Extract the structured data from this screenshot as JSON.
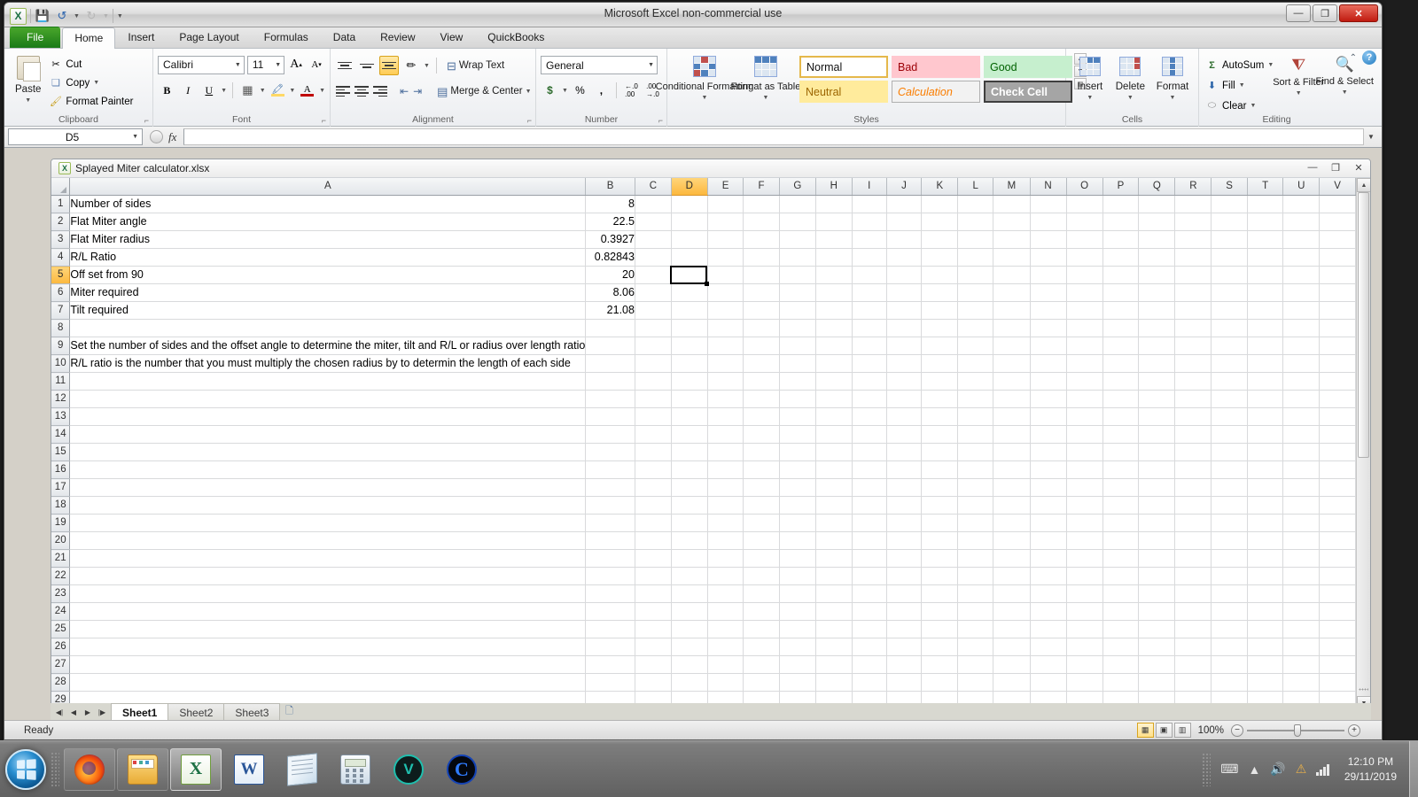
{
  "window": {
    "title": "Microsoft Excel non-commercial use",
    "minimize_label": "—",
    "maximize_label": "❐",
    "close_label": "✕"
  },
  "quick_access": {
    "excel_logo": "X",
    "save_icon": "save-icon",
    "undo_icon": "undo-icon",
    "redo_icon": "redo-icon",
    "customize_icon": "customize-qat-icon"
  },
  "ribbon": {
    "tabs": [
      {
        "label": "File",
        "active": false,
        "type": "file"
      },
      {
        "label": "Home",
        "active": true
      },
      {
        "label": "Insert",
        "active": false
      },
      {
        "label": "Page Layout",
        "active": false
      },
      {
        "label": "Formulas",
        "active": false
      },
      {
        "label": "Data",
        "active": false
      },
      {
        "label": "Review",
        "active": false
      },
      {
        "label": "View",
        "active": false
      },
      {
        "label": "QuickBooks",
        "active": false
      }
    ],
    "minimize_ribbon": "⌃",
    "help": "?",
    "groups": {
      "clipboard": {
        "name": "Clipboard",
        "paste": "Paste",
        "cut": "Cut",
        "copy": "Copy",
        "format_painter": "Format Painter",
        "launcher": "⌐"
      },
      "font": {
        "name": "Font",
        "font_name": "Calibri",
        "font_size": "11",
        "grow_font": "A",
        "shrink_font": "A",
        "bold": "B",
        "italic": "I",
        "underline": "U",
        "borders": "borders-icon",
        "fill_color": "fill-color-icon",
        "font_color": "A",
        "launcher": "⌐"
      },
      "alignment": {
        "name": "Alignment",
        "top_align": "top-align-icon",
        "middle_align": "middle-align-icon",
        "bottom_align": "bottom-align-icon",
        "orientation": "orientation-icon",
        "wrap_text": "Wrap Text",
        "align_left": "align-left-icon",
        "align_center": "align-center-icon",
        "align_right": "align-right-icon",
        "decrease_indent": "decrease-indent-icon",
        "increase_indent": "increase-indent-icon",
        "merge_center": "Merge & Center",
        "launcher": "⌐"
      },
      "number": {
        "name": "Number",
        "format": "General",
        "accounting": "$",
        "percent": "%",
        "comma": ",",
        "increase_decimal": "increase-decimal-icon",
        "decrease_decimal": "decrease-decimal-icon",
        "launcher": "⌐"
      },
      "styles": {
        "name": "Styles",
        "conditional_formatting": "Conditional Formatting",
        "format_as_table": "Format as Table",
        "cell_styles": [
          {
            "label": "Normal",
            "variant": "normal"
          },
          {
            "label": "Bad",
            "variant": "bad"
          },
          {
            "label": "Good",
            "variant": "good"
          },
          {
            "label": "Neutral",
            "variant": "neutral"
          },
          {
            "label": "Calculation",
            "variant": "calc"
          },
          {
            "label": "Check Cell",
            "variant": "check"
          }
        ]
      },
      "cells": {
        "name": "Cells",
        "insert": "Insert",
        "delete": "Delete",
        "format": "Format"
      },
      "editing": {
        "name": "Editing",
        "autosum": "AutoSum",
        "fill": "Fill",
        "clear": "Clear",
        "sort_filter": "Sort & Filter",
        "find_select": "Find & Select"
      }
    }
  },
  "formula_bar": {
    "name_box": "D5",
    "formula": "",
    "fx_label": "fx",
    "expand_icon": "expand-formula-bar-icon"
  },
  "workbook": {
    "filename": "Splayed Miter calculator.xlsx",
    "minimize": "—",
    "maximize": "❐",
    "close": "✕"
  },
  "grid": {
    "columns": [
      "A",
      "B",
      "C",
      "D",
      "E",
      "F",
      "G",
      "H",
      "I",
      "J",
      "K",
      "L",
      "M",
      "N",
      "O",
      "P",
      "Q",
      "R",
      "S",
      "T",
      "U",
      "V"
    ],
    "selected_column": "D",
    "selected_row": 5,
    "selected_cell": "D5",
    "row_count": 30,
    "cells": {
      "1": {
        "A": "Number of sides",
        "B": "8"
      },
      "2": {
        "A": "Flat Miter angle",
        "B": "22.5"
      },
      "3": {
        "A": "Flat Miter radius",
        "B": "0.3927"
      },
      "4": {
        "A": "R/L Ratio",
        "B": "0.82843"
      },
      "5": {
        "A": "Off set from 90",
        "B": "20"
      },
      "6": {
        "A": "Miter required",
        "B": "8.06"
      },
      "7": {
        "A": "Tilt required",
        "B": "21.08"
      },
      "9": {
        "A": "Set the number of sides and the offset angle to determine the miter, tilt and R/L or radius over length ratio"
      },
      "10": {
        "A": "R/L ratio is the number that you must multiply the chosen radius by to determin the length of each side"
      }
    }
  },
  "sheet_tabs": {
    "nav_first": "◀|",
    "nav_prev": "◀",
    "nav_next": "▶",
    "nav_last": "|▶",
    "tabs": [
      {
        "label": "Sheet1",
        "active": true
      },
      {
        "label": "Sheet2",
        "active": false
      },
      {
        "label": "Sheet3",
        "active": false
      }
    ],
    "insert_sheet": "insert-worksheet-icon"
  },
  "status_bar": {
    "status": "Ready",
    "view_normal": "normal-view-icon",
    "view_page_layout": "page-layout-view-icon",
    "view_page_break": "page-break-view-icon",
    "zoom": "100%",
    "zoom_out": "−",
    "zoom_in": "+"
  },
  "taskbar": {
    "start": "start-button",
    "items": [
      {
        "name": "firefox",
        "icon": "firefox-icon",
        "label": ""
      },
      {
        "name": "file-explorer",
        "icon": "file-explorer-icon",
        "label": ""
      },
      {
        "name": "excel",
        "icon": "excel-icon",
        "label": "X",
        "active": true
      },
      {
        "name": "word",
        "icon": "word-icon",
        "label": "W"
      },
      {
        "name": "notepad",
        "icon": "notepad-icon",
        "label": ""
      },
      {
        "name": "calculator",
        "icon": "calculator-icon",
        "label": ""
      },
      {
        "name": "vpn",
        "icon": "shield-icon",
        "label": "V"
      },
      {
        "name": "chrome-like",
        "icon": "circle-c-icon",
        "label": "C"
      }
    ],
    "tray": {
      "keyboard": "keyboard-icon",
      "show_hidden": "▲",
      "volume": "volume-icon",
      "network_alert": "network-warning-icon",
      "signal": "signal-icon",
      "time": "12:10 PM",
      "date": "29/11/2019"
    }
  },
  "colors": {
    "accent_orange": "#fcb83e",
    "file_tab_green": "#1a7a18",
    "bad_bg": "#ffc7ce",
    "good_bg": "#c6efce",
    "neutral_bg": "#ffeb9c",
    "check_cell_bg": "#a5a5a5"
  }
}
